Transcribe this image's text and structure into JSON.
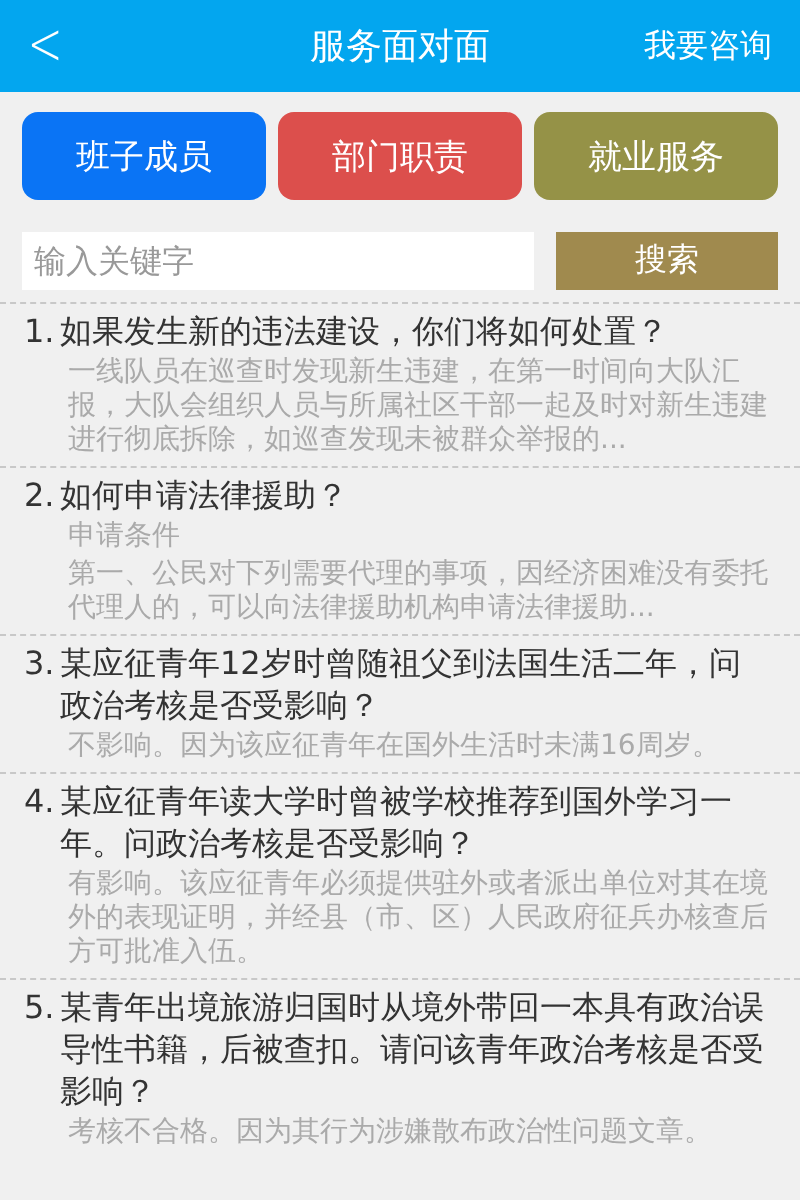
{
  "header": {
    "back": "<",
    "title": "服务面对面",
    "action": "我要咨询"
  },
  "categories": [
    {
      "label": "班子成员",
      "color": "#0a74f5"
    },
    {
      "label": "部门职责",
      "color": "#dc4f4c"
    },
    {
      "label": "就业服务",
      "color": "#959247"
    }
  ],
  "search": {
    "placeholder": "输入关键字",
    "button": "搜索"
  },
  "faq": [
    {
      "number": "1.",
      "question": "如果发生新的违法建设，你们将如何处置？",
      "answer": "一线队员在巡查时发现新生违建，在第一时间向大队汇报，大队会组织人员与所属社区干部一起及时对新生违建进行彻底拆除，如巡查发现未被群众举报的..."
    },
    {
      "number": "2.",
      "question": "如何申请法律援助？",
      "answer_title": "申请条件",
      "answer": "第一、公民对下列需要代理的事项，因经济困难没有委托代理人的，可以向法律援助机构申请法律援助..."
    },
    {
      "number": "3.",
      "question": "某应征青年12岁时曾随祖父到法国生活二年，问政治考核是否受影响？",
      "answer": "不影响。因为该应征青年在国外生活时未满16周岁。"
    },
    {
      "number": "4.",
      "question": "某应征青年读大学时曾被学校推荐到国外学习一年。问政治考核是否受影响？",
      "answer": "有影响。该应征青年必须提供驻外或者派出单位对其在境外的表现证明，并经县（市、区）人民政府征兵办核查后方可批准入伍。"
    },
    {
      "number": "5.",
      "question": "某青年出境旅游归国时从境外带回一本具有政治误导性书籍，后被查扣。请问该青年政治考核是否受影响？",
      "answer": "考核不合格。因为其行为涉嫌散布政治性问题文章。"
    }
  ]
}
